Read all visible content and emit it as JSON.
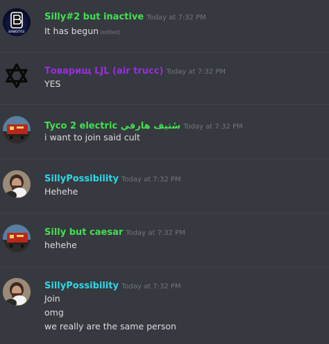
{
  "colors": {
    "background": "#36393f",
    "divider": "#3f4247",
    "text": "#dcddde",
    "timestamp": "#72767d",
    "green_name": "#43e050",
    "purple_name": "#9b2dde",
    "cyan_name": "#2fd7e6"
  },
  "messages": [
    {
      "author": "Silly#2 but inactive",
      "name_color": "#43e050",
      "timestamp": "Today at 7:32 PM",
      "avatar_icon": "b-logo-avatar-icon",
      "avatar_text": "BANKSTYLE",
      "lines": [
        "It has begun"
      ],
      "edited_label": "(edited)"
    },
    {
      "author": "Товарищ LJL (air trucc)",
      "name_color": "#9b2dde",
      "timestamp": "Today at 7:32 PM",
      "avatar_icon": "hexagram-avatar-icon",
      "lines": [
        "YES"
      ]
    },
    {
      "author": "Tyco 2 electric سٔتيف هارفي",
      "name_color": "#43e050",
      "timestamp": "Today at 7:32 PM",
      "avatar_icon": "train-avatar-icon",
      "lines": [
        "i want to join said cult"
      ]
    },
    {
      "author": "SillyPossibility",
      "name_color": "#2fd7e6",
      "timestamp": "Today at 7:32 PM",
      "avatar_icon": "person-avatar-icon",
      "lines": [
        "Hehehe"
      ]
    },
    {
      "author": "Silly but caesar",
      "name_color": "#43e050",
      "timestamp": "Today at 7:32 PM",
      "avatar_icon": "train-avatar-icon",
      "lines": [
        "hehehe"
      ]
    },
    {
      "author": "SillyPossibility",
      "name_color": "#2fd7e6",
      "timestamp": "Today at 7:32 PM",
      "avatar_icon": "person-avatar-icon",
      "lines": [
        "Join",
        "omg",
        "we really are the same person"
      ]
    }
  ]
}
